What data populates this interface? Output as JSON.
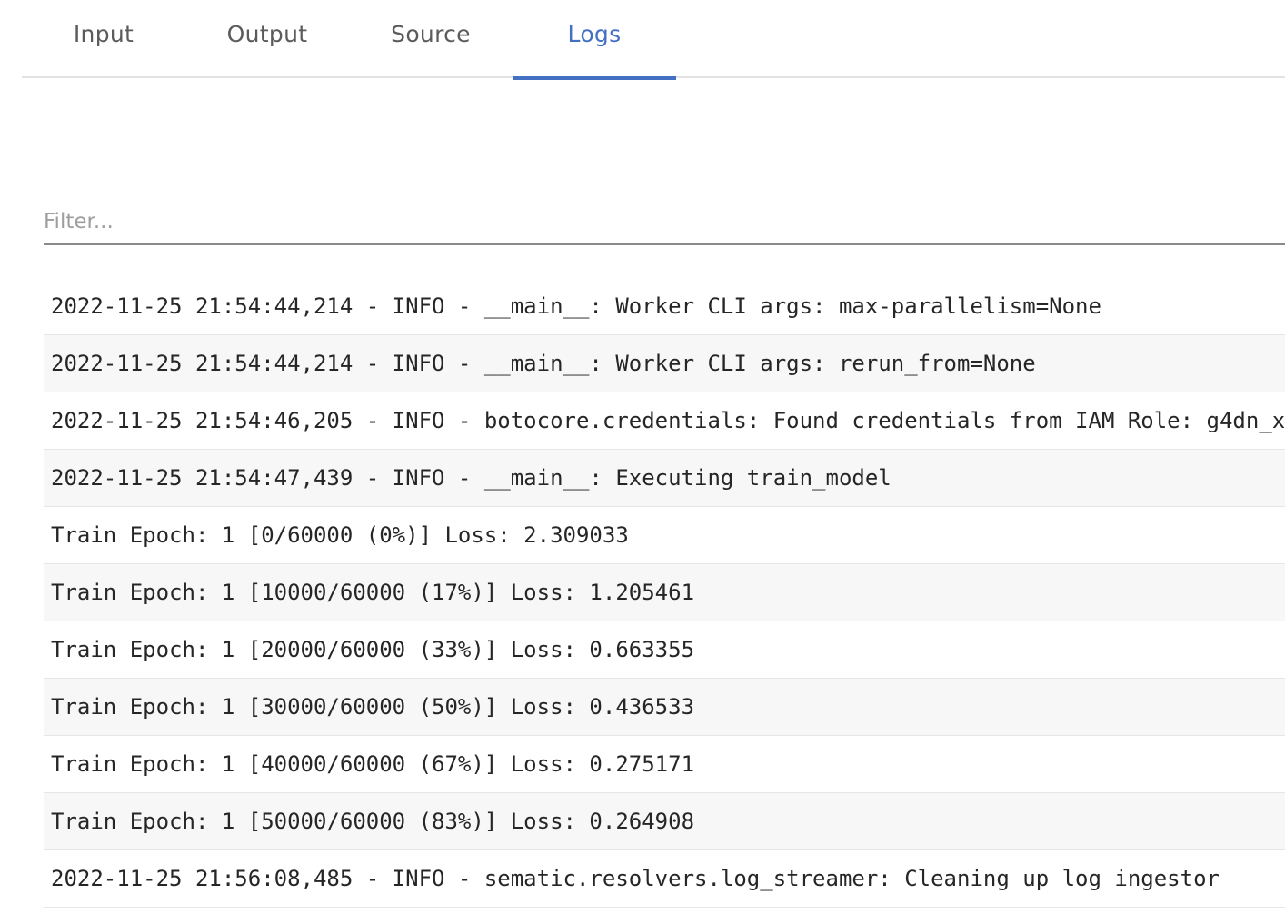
{
  "tabs": [
    {
      "label": "Input",
      "active": false
    },
    {
      "label": "Output",
      "active": false
    },
    {
      "label": "Source",
      "active": false
    },
    {
      "label": "Logs",
      "active": true
    }
  ],
  "colors": {
    "accent": "#4470c4",
    "row_alt": "#f7f7f7"
  },
  "filter": {
    "placeholder": "Filter...",
    "value": ""
  },
  "logs": [
    "2022-11-25 21:54:44,214 - INFO - __main__: Worker CLI args: max-parallelism=None",
    "2022-11-25 21:54:44,214 - INFO - __main__: Worker CLI args: rerun_from=None",
    "2022-11-25 21:54:46,205 - INFO - botocore.credentials: Found credentials from IAM Role: g4dn_x",
    "2022-11-25 21:54:47,439 - INFO - __main__: Executing train_model",
    "Train Epoch: 1 [0/60000 (0%)] Loss: 2.309033",
    "Train Epoch: 1 [10000/60000 (17%)] Loss: 1.205461",
    "Train Epoch: 1 [20000/60000 (33%)] Loss: 0.663355",
    "Train Epoch: 1 [30000/60000 (50%)] Loss: 0.436533",
    "Train Epoch: 1 [40000/60000 (67%)] Loss: 0.275171",
    "Train Epoch: 1 [50000/60000 (83%)] Loss: 0.264908",
    "2022-11-25 21:56:08,485 - INFO - sematic.resolvers.log_streamer: Cleaning up log ingestor"
  ]
}
